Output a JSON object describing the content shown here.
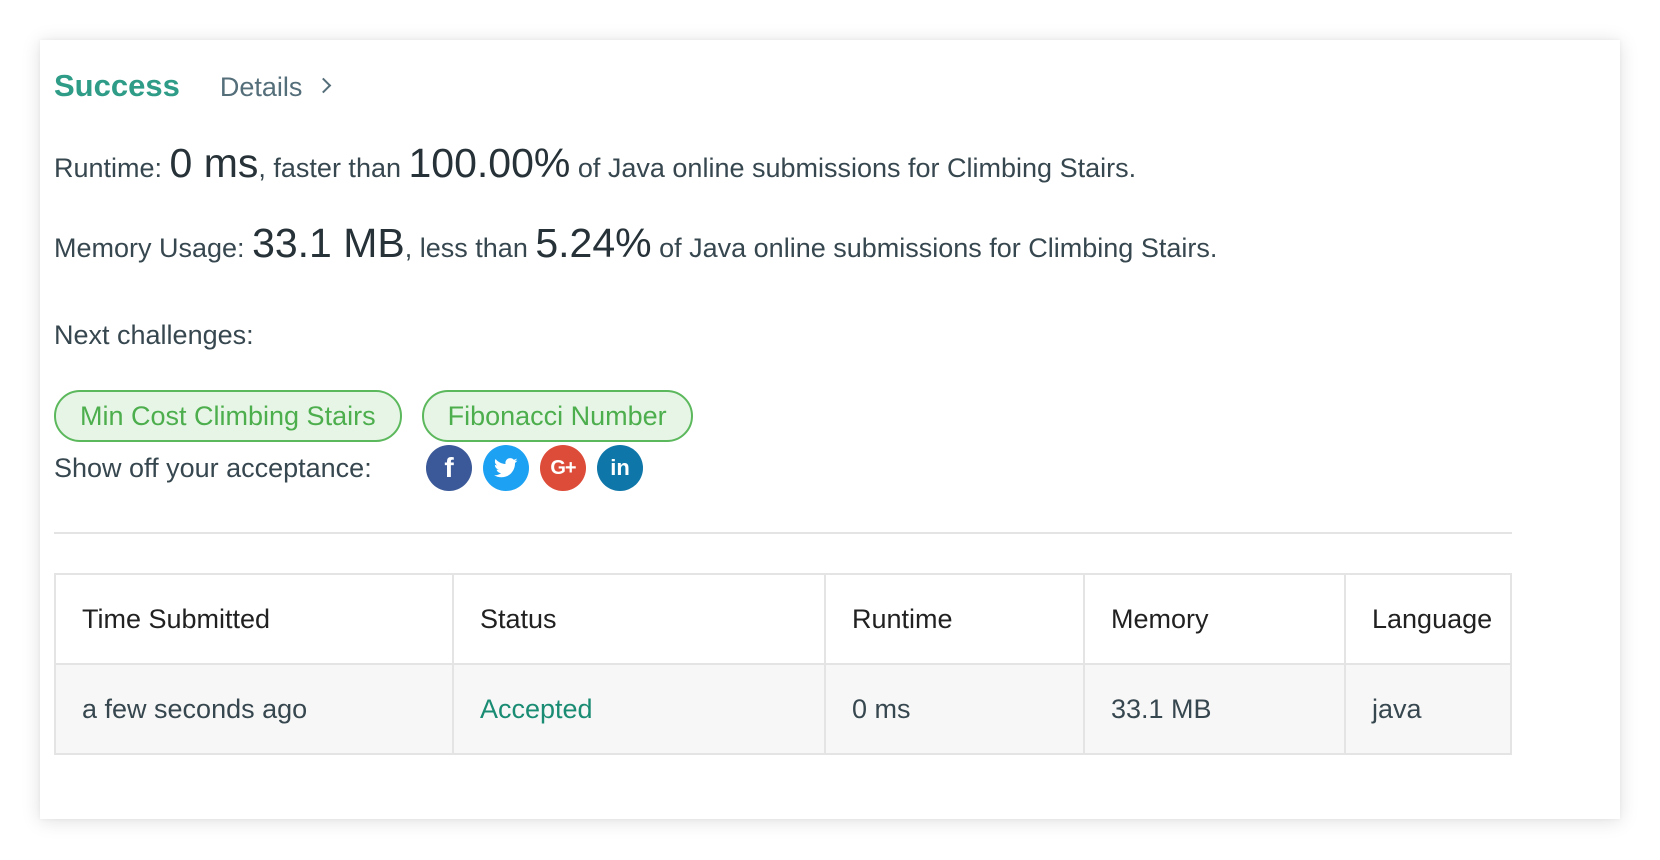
{
  "header": {
    "status": "Success",
    "details_label": "Details"
  },
  "runtime": {
    "label": "Runtime: ",
    "value": "0 ms",
    "comparison": ", faster than ",
    "percent": "100.00%",
    "suffix": " of Java online submissions for Climbing Stairs."
  },
  "memory": {
    "label": "Memory Usage: ",
    "value": "33.1 MB",
    "comparison": ", less than ",
    "percent": "5.24%",
    "suffix": " of Java online submissions for Climbing Stairs."
  },
  "next": {
    "label": "Next challenges:",
    "challenges": [
      "Min Cost Climbing Stairs",
      "Fibonacci Number"
    ]
  },
  "share": {
    "label": "Show off your acceptance:",
    "icons": {
      "facebook": "f",
      "twitter": "twitter-bird",
      "google_plus": "G+",
      "linkedin": "in"
    }
  },
  "table": {
    "headers": [
      "Time Submitted",
      "Status",
      "Runtime",
      "Memory",
      "Language"
    ],
    "rows": [
      [
        "a few seconds ago",
        "Accepted",
        "0 ms",
        "33.1 MB",
        "java"
      ]
    ]
  },
  "colors": {
    "success": "#2e9c87",
    "accepted": "#1a8c73",
    "pill_border": "#5cb85c",
    "pill_bg": "#e7f5e7",
    "facebook": "#3b5998",
    "twitter": "#1da1f2",
    "google_plus": "#dd4b39",
    "linkedin": "#0e76a8"
  }
}
